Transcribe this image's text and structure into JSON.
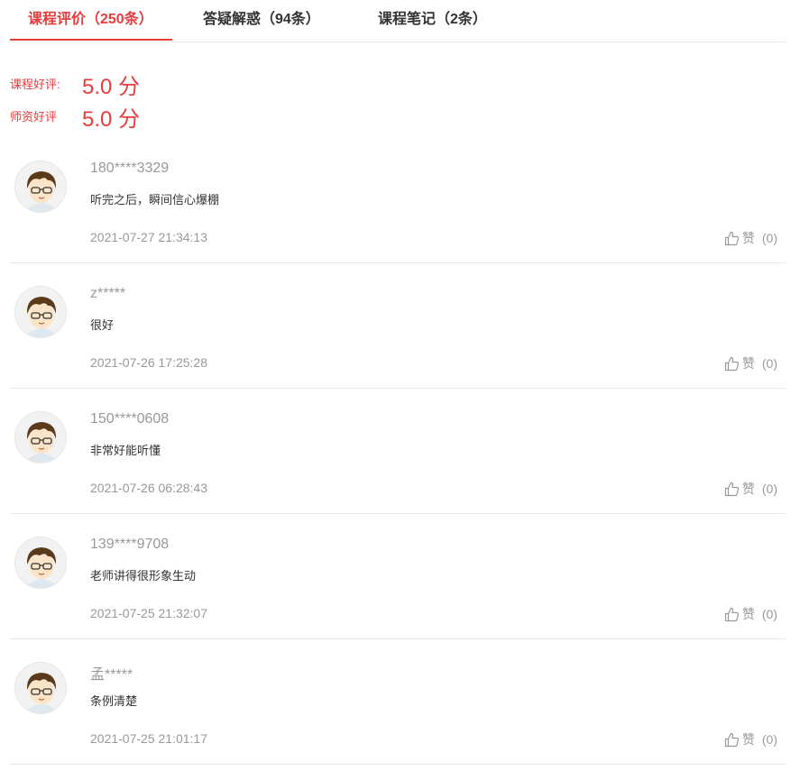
{
  "tabs": [
    {
      "label": "课程评价（250条）"
    },
    {
      "label": "答疑解惑（94条）"
    },
    {
      "label": "课程笔记（2条）"
    }
  ],
  "ratings": {
    "course": {
      "label": "课程好评:",
      "value": "5.0 分"
    },
    "teacher": {
      "label": "师资好评",
      "value": "5.0 分"
    }
  },
  "like_label": "赞",
  "reviews": [
    {
      "user": "180****3329",
      "comment": "听完之后，瞬间信心爆棚",
      "time": "2021-07-27 21:34:13",
      "likes": "(0)"
    },
    {
      "user": "z*****",
      "comment": "很好",
      "time": "2021-07-26 17:25:28",
      "likes": "(0)"
    },
    {
      "user": "150****0608",
      "comment": "非常好能听懂",
      "time": "2021-07-26 06:28:43",
      "likes": "(0)"
    },
    {
      "user": "139****9708",
      "comment": "老师讲得很形象生动",
      "time": "2021-07-25 21:32:07",
      "likes": "(0)"
    },
    {
      "user": "孟*****",
      "comment": "条例清楚",
      "time": "2021-07-25 21:01:17",
      "likes": "(0)"
    }
  ],
  "colors": {
    "accent": "#e73c3c",
    "muted": "#999999",
    "divider": "#e8e8e8"
  }
}
